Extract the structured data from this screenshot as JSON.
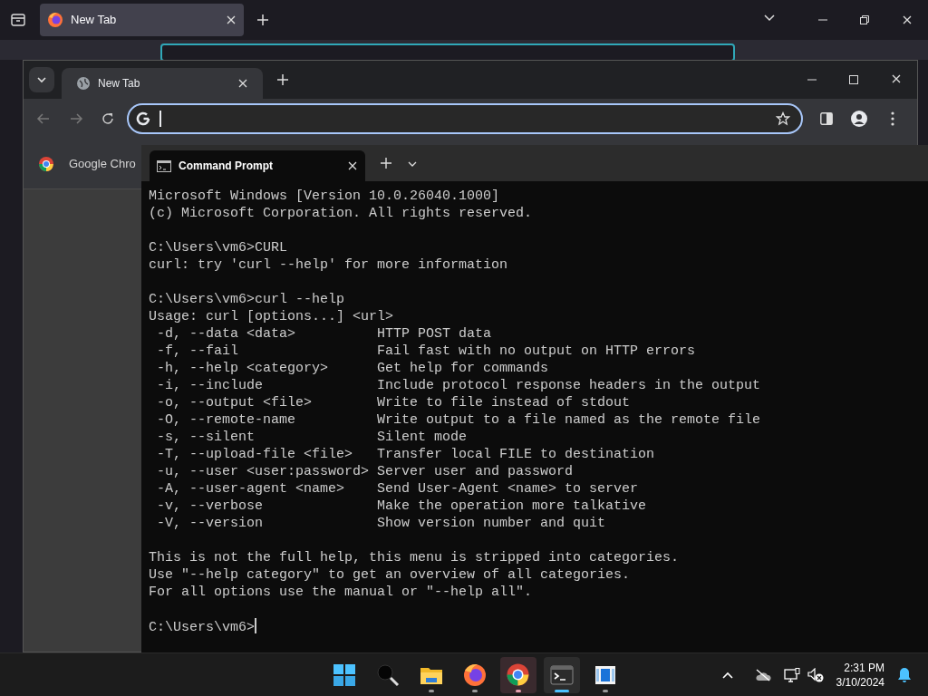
{
  "firefox": {
    "tabs": [
      {
        "title": "New Tab",
        "selected": true
      }
    ]
  },
  "chrome": {
    "tabs": [
      {
        "title": "New Tab",
        "selected": true
      }
    ],
    "bookmarks": [
      {
        "label": "Google Chro"
      }
    ]
  },
  "terminal": {
    "tabs": [
      {
        "title": "Command Prompt",
        "selected": true
      }
    ],
    "blocks": [
      [
        {
          "kind": "text",
          "text": "Microsoft Windows [Version 10.0.26040.1000]"
        },
        {
          "kind": "text",
          "text": "(c) Microsoft Corporation. All rights reserved."
        }
      ],
      [
        {
          "kind": "text",
          "text": "C:\\Users\\vm6>CURL"
        },
        {
          "kind": "text",
          "text": "curl: try 'curl --help' for more information"
        }
      ],
      [
        {
          "kind": "text",
          "text": "C:\\Users\\vm6>curl --help"
        },
        {
          "kind": "text",
          "text": "Usage: curl [options...] <url>"
        },
        {
          "kind": "option",
          "option": "-d, --data <data>",
          "description": "HTTP POST data"
        },
        {
          "kind": "option",
          "option": "-f, --fail",
          "description": "Fail fast with no output on HTTP errors"
        },
        {
          "kind": "option",
          "option": "-h, --help <category>",
          "description": "Get help for commands"
        },
        {
          "kind": "option",
          "option": "-i, --include",
          "description": "Include protocol response headers in the output"
        },
        {
          "kind": "option",
          "option": "-o, --output <file>",
          "description": "Write to file instead of stdout"
        },
        {
          "kind": "option",
          "option": "-O, --remote-name",
          "description": "Write output to a file named as the remote file"
        },
        {
          "kind": "option",
          "option": "-s, --silent",
          "description": "Silent mode"
        },
        {
          "kind": "option",
          "option": "-T, --upload-file <file>",
          "description": "Transfer local FILE to destination"
        },
        {
          "kind": "option",
          "option": "-u, --user <user:password>",
          "description": "Server user and password"
        },
        {
          "kind": "option",
          "option": "-A, --user-agent <name>",
          "description": "Send User-Agent <name> to server"
        },
        {
          "kind": "option",
          "option": "-v, --verbose",
          "description": "Make the operation more talkative"
        },
        {
          "kind": "option",
          "option": "-V, --version",
          "description": "Show version number and quit"
        }
      ],
      [
        {
          "kind": "text",
          "text": "This is not the full help, this menu is stripped into categories."
        },
        {
          "kind": "text",
          "text": "Use \"--help category\" to get an overview of all categories."
        },
        {
          "kind": "text",
          "text": "For all options use the manual or \"--help all\"."
        }
      ]
    ],
    "prompt": "C:\\Users\\vm6>"
  },
  "taskbar": {
    "apps": [
      {
        "kind": "start",
        "running": false,
        "active": false,
        "highlighted": false
      },
      {
        "kind": "search",
        "running": false,
        "active": false,
        "highlighted": false
      },
      {
        "kind": "files",
        "running": true,
        "active": false,
        "highlighted": false
      },
      {
        "kind": "firefox",
        "running": true,
        "active": false,
        "highlighted": false
      },
      {
        "kind": "chrome",
        "running": true,
        "active": false,
        "highlighted": true
      },
      {
        "kind": "terminal",
        "running": true,
        "active": true,
        "highlighted": false
      },
      {
        "kind": "viewer",
        "running": true,
        "active": false,
        "highlighted": false
      }
    ],
    "clock": {
      "time": "2:31 PM",
      "date": "3/10/2024"
    }
  }
}
